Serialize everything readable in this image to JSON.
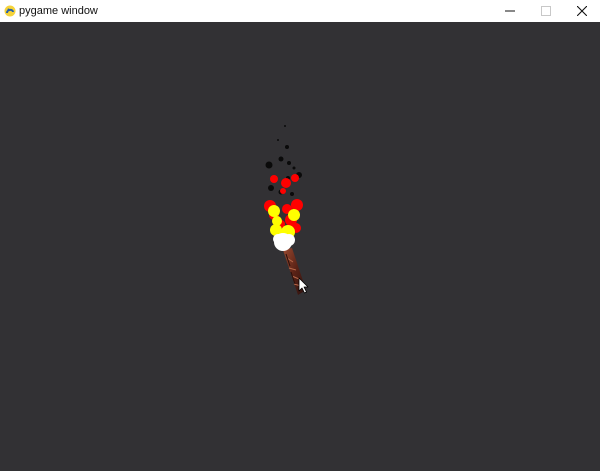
{
  "window": {
    "title": "pygame window",
    "app_icon": "pygame-snake-icon",
    "controls": {
      "minimize_icon": "minimize-icon",
      "maximize_icon": "maximize-icon",
      "close_icon": "close-icon"
    }
  },
  "canvas": {
    "background": "#323134",
    "scene": "torch-with-fire-particles",
    "colors": {
      "smoke": "#0a0a0a",
      "flame_red": "#ff0000",
      "flame_yellow": "#ffff00",
      "flame_core": "#ffffff",
      "torch_wood": "#6b2a1e"
    },
    "cursor_icon": "mouse-pointer-icon"
  }
}
